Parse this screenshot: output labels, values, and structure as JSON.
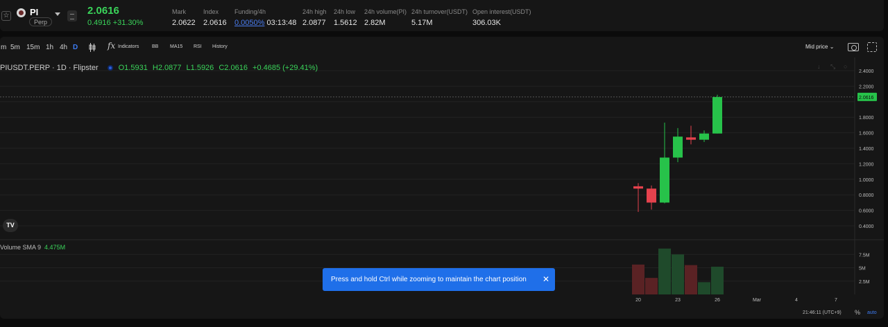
{
  "ticker": {
    "symbol": "PI",
    "contract": "Perp",
    "last_price": "2.0616",
    "change": "0.4916 +31.30%",
    "stats": [
      {
        "label": "Mark",
        "value": "2.0622"
      },
      {
        "label": "Index",
        "value": "2.0616"
      },
      {
        "label": "Funding/4h",
        "value": "0.0050%",
        "extra": "03:13:48"
      },
      {
        "label": "24h high",
        "value": "2.0877"
      },
      {
        "label": "24h low",
        "value": "1.5612"
      },
      {
        "label": "24h volume(PI)",
        "value": "2.82M"
      },
      {
        "label": "24h turnover(USDT)",
        "value": "5.17M"
      },
      {
        "label": "Open interest(USDT)",
        "value": "306.03K"
      }
    ]
  },
  "toolbar": {
    "timeframes": [
      "m",
      "5m",
      "15m",
      "1h",
      "4h",
      "D"
    ],
    "active_timeframe": "D",
    "tools": [
      "Indicators",
      "BB",
      "MA15",
      "RSI",
      "History"
    ],
    "price_mode": "Mid price"
  },
  "legend": {
    "symbol": "PIUSDT.PERP · 1D · Flipster",
    "open": "O1.5931",
    "high": "H2.0877",
    "low": "L1.5926",
    "close": "C2.0616",
    "change": "+0.4685 (+29.41%)"
  },
  "volume_legend": {
    "label": "Volume SMA 9",
    "value": "4.475M"
  },
  "logo_text": "TV",
  "toast": {
    "message": "Press and hold Ctrl while zooming to maintain the chart position",
    "close": "✕"
  },
  "status": {
    "clock": "21:46:11 (UTC+9)",
    "percent": "%",
    "auto": "auto"
  },
  "colors": {
    "up": "#27c24a",
    "down": "#e5424d",
    "accent": "#3d7cf4",
    "toast": "#1f6fe9"
  },
  "chart_data": {
    "type": "candlestick",
    "price_axis": [
      "2.4000",
      "2.2000",
      "2.0616",
      "1.8000",
      "1.6000",
      "1.4000",
      "1.2000",
      "1.0000",
      "0.8000",
      "0.6000",
      "0.4000"
    ],
    "current_price_label": "2.0616",
    "ylim": [
      0.4,
      2.4
    ],
    "volume_axis": [
      "7.5M",
      "5M",
      "2.5M"
    ],
    "x_ticks": [
      {
        "label": "20",
        "day": 20
      },
      {
        "label": "23",
        "day": 23
      },
      {
        "label": "26",
        "day": 26
      },
      {
        "label": "Mar",
        "day": 29
      },
      {
        "label": "4",
        "day": 32
      },
      {
        "label": "7",
        "day": 35
      }
    ],
    "candles": [
      {
        "day": 20,
        "open": 0.91,
        "high": 0.95,
        "low": 0.58,
        "close": 0.88
      },
      {
        "day": 21,
        "open": 0.88,
        "high": 0.92,
        "low": 0.61,
        "close": 0.7
      },
      {
        "day": 22,
        "open": 0.7,
        "high": 1.73,
        "low": 0.69,
        "close": 1.28
      },
      {
        "day": 23,
        "open": 1.28,
        "high": 1.66,
        "low": 1.22,
        "close": 1.55
      },
      {
        "day": 24,
        "open": 1.54,
        "high": 1.69,
        "low": 1.45,
        "close": 1.51
      },
      {
        "day": 25,
        "open": 1.51,
        "high": 1.63,
        "low": 1.48,
        "close": 1.59
      },
      {
        "day": 26,
        "open": 1.59,
        "high": 2.09,
        "low": 1.59,
        "close": 2.06
      }
    ],
    "volumes": [
      {
        "day": 20,
        "value": 5.6
      },
      {
        "day": 21,
        "value": 3.1
      },
      {
        "day": 22,
        "value": 8.6
      },
      {
        "day": 23,
        "value": 7.5
      },
      {
        "day": 24,
        "value": 5.5
      },
      {
        "day": 25,
        "value": 2.3
      },
      {
        "day": 26,
        "value": 5.2
      }
    ],
    "volume_max": 10
  }
}
